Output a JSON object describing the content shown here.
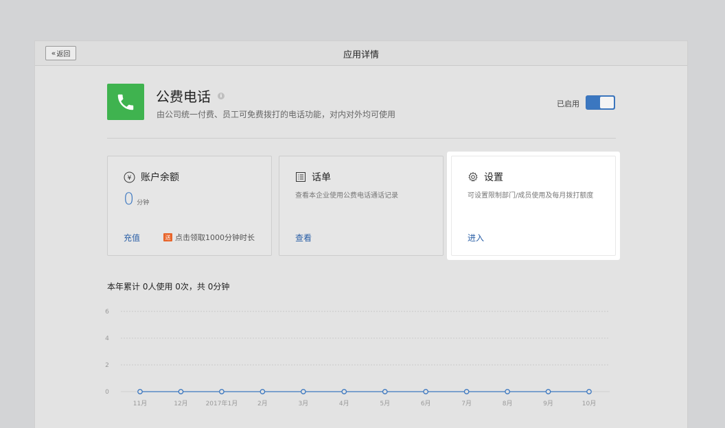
{
  "header": {
    "back_label": "返回",
    "back_icon": "double-chevron-left-icon",
    "title": "应用详情"
  },
  "app": {
    "name": "公费电话",
    "description": "由公司统一付费、员工可免费拨打的电话功能，对内对外均可使用",
    "icon": "phone-icon",
    "icon_color": "#3fb34f",
    "status_label": "已启用",
    "enabled": true,
    "toggle_color": "#3b77c0"
  },
  "cards": {
    "balance": {
      "title": "账户余额",
      "icon": "yen-circle-icon",
      "value": "0",
      "unit": "分钟",
      "action": "充值",
      "promo_tag": "送",
      "promo_text": "点击领取1000分钟时长"
    },
    "records": {
      "title": "话单",
      "icon": "list-icon",
      "description": "查看本企业使用公费电话通话记录",
      "action": "查看"
    },
    "settings": {
      "title": "设置",
      "icon": "gear-icon",
      "description": "可设置限制部门/成员使用及每月拨打额度",
      "action": "进入"
    }
  },
  "summary": "本年累计 0人使用 0次，共 0分钟",
  "chart_data": {
    "type": "line",
    "categories": [
      "11月",
      "12月",
      "2017年1月",
      "2月",
      "3月",
      "4月",
      "5月",
      "6月",
      "7月",
      "8月",
      "9月",
      "10月"
    ],
    "series": [
      {
        "values": [
          0,
          0,
          0,
          0,
          0,
          0,
          0,
          0,
          0,
          0,
          0,
          0
        ]
      }
    ],
    "yticks": [
      "0",
      "2",
      "4",
      "6"
    ],
    "ylim": [
      0,
      6
    ],
    "grid": true,
    "line_color": "#3b77c0"
  }
}
